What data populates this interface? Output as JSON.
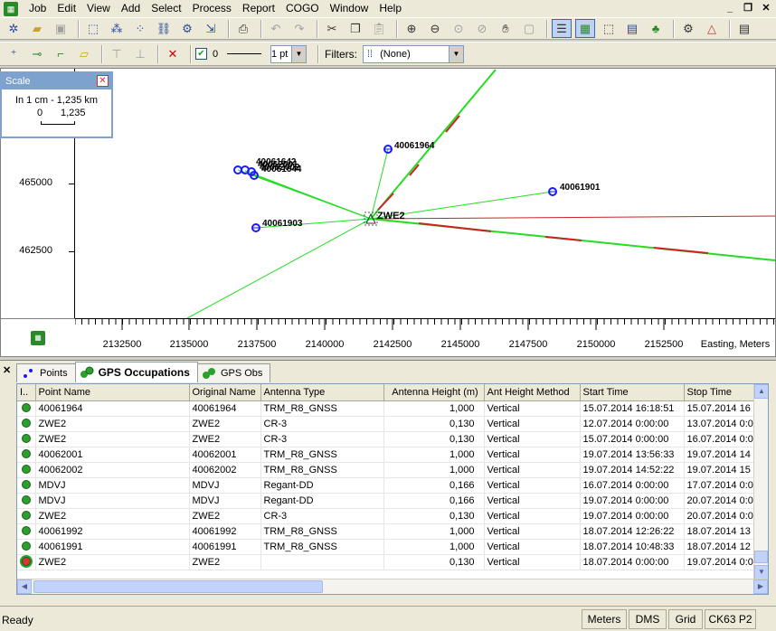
{
  "menu": [
    "Job",
    "Edit",
    "View",
    "Add",
    "Select",
    "Process",
    "Report",
    "COGO",
    "Window",
    "Help"
  ],
  "window_buttons": [
    "_",
    "❐",
    "✕"
  ],
  "toolbar2": {
    "checkbox_checked": true,
    "line_width_value": "0",
    "point_size_value": "1 pt",
    "filters_label": "Filters:",
    "filters_value": "(None)"
  },
  "scale_panel": {
    "title": "Scale",
    "text": "In 1 cm - 1,235 km",
    "bar_start": "0",
    "bar_end": "1,235"
  },
  "map": {
    "y_ticks": [
      "465000",
      "462500"
    ],
    "x_ticks": [
      "2132500",
      "2135000",
      "2137500",
      "2140000",
      "2142500",
      "2145000",
      "2147500",
      "2150000",
      "2152500"
    ],
    "x_axis_title": "Easting, Meters",
    "center_point": "ZWE2",
    "points": [
      "40061964",
      "40061642",
      "40061903",
      "40061901"
    ],
    "cluster_labels": [
      "40061642",
      "40062001",
      "40062002",
      "40061644"
    ]
  },
  "tabs": [
    {
      "label": "Points",
      "icon": "points-icon"
    },
    {
      "label": "GPS Occupations",
      "icon": "gps-occupations-icon"
    },
    {
      "label": "GPS Obs",
      "icon": "gps-obs-icon"
    }
  ],
  "table": {
    "columns": [
      "I..",
      "Point Name",
      "Original Name",
      "Antenna Type",
      "Antenna Height (m)",
      "Ant Height Method",
      "Start Time",
      "Stop Time"
    ],
    "rows": [
      [
        "40061964",
        "40061964",
        "TRM_R8_GNSS",
        "1,000",
        "Vertical",
        "15.07.2014 16:18:51",
        "15.07.2014 16"
      ],
      [
        "ZWE2",
        "ZWE2",
        "CR-3",
        "0,130",
        "Vertical",
        "12.07.2014 0:00:00",
        "13.07.2014 0:0"
      ],
      [
        "ZWE2",
        "ZWE2",
        "CR-3",
        "0,130",
        "Vertical",
        "15.07.2014 0:00:00",
        "16.07.2014 0:0"
      ],
      [
        "40062001",
        "40062001",
        "TRM_R8_GNSS",
        "1,000",
        "Vertical",
        "19.07.2014 13:56:33",
        "19.07.2014 14"
      ],
      [
        "40062002",
        "40062002",
        "TRM_R8_GNSS",
        "1,000",
        "Vertical",
        "19.07.2014 14:52:22",
        "19.07.2014 15"
      ],
      [
        "MDVJ",
        "MDVJ",
        "Regant-DD",
        "0,166",
        "Vertical",
        "16.07.2014 0:00:00",
        "17.07.2014 0:0"
      ],
      [
        "MDVJ",
        "MDVJ",
        "Regant-DD",
        "0,166",
        "Vertical",
        "19.07.2014 0:00:00",
        "20.07.2014 0:0"
      ],
      [
        "ZWE2",
        "ZWE2",
        "CR-3",
        "0,130",
        "Vertical",
        "19.07.2014 0:00:00",
        "20.07.2014 0:0"
      ],
      [
        "40061992",
        "40061992",
        "TRM_R8_GNSS",
        "1,000",
        "Vertical",
        "18.07.2014 12:26:22",
        "18.07.2014 13"
      ],
      [
        "40061991",
        "40061991",
        "TRM_R8_GNSS",
        "1,000",
        "Vertical",
        "18.07.2014 10:48:33",
        "18.07.2014 12"
      ],
      [
        "ZWE2",
        "ZWE2",
        "",
        "0,130",
        "Vertical",
        "18.07.2014 0:00:00",
        "19.07.2014 0:0"
      ]
    ]
  },
  "status": {
    "text": "Ready",
    "panels": [
      "Meters",
      "DMS",
      "Grid",
      "CK63 P2"
    ]
  },
  "colors": {
    "line_green": "#22dd22",
    "line_red": "#cc2222",
    "point_blue": "#1a1aff",
    "scale_title_bg": "#7da2ce"
  }
}
